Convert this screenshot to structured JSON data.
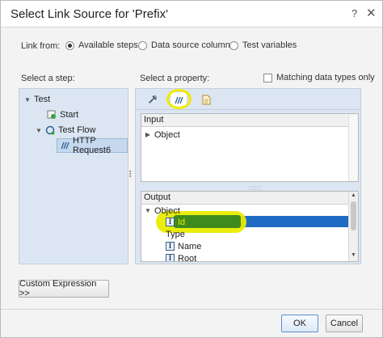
{
  "window": {
    "title": "Select Link Source for 'Prefix'",
    "help": "?",
    "close": "✕"
  },
  "link_from": {
    "label": "Link from:",
    "options": [
      {
        "label": "Available steps",
        "selected": true
      },
      {
        "label": "Data source column",
        "selected": false
      },
      {
        "label": "Test variables",
        "selected": false
      }
    ]
  },
  "steps": {
    "label": "Select a step:",
    "tree": [
      {
        "label": "Test",
        "icon": "chevron-down-icon"
      },
      {
        "label": "Start",
        "icon": "start-step-icon"
      },
      {
        "label": "Test Flow",
        "icon": "flow-icon"
      },
      {
        "label": "HTTP Request6",
        "icon": "http-request-icon"
      }
    ]
  },
  "property": {
    "label": "Select a property:",
    "matching_label": "Matching data types only",
    "tabs": [
      "tools-tab",
      "http-tab",
      "document-tab"
    ],
    "input": {
      "header": "Input",
      "rows": [
        "Object"
      ]
    },
    "output": {
      "header": "Output",
      "rows": [
        "Object",
        "Id",
        "Type",
        "Name",
        "Root"
      ]
    }
  },
  "buttons": {
    "custom_expression": "Custom Expression >>",
    "ok": "OK",
    "cancel": "Cancel"
  },
  "colors": {
    "panel_bg": "#dbe6f2",
    "selection": "#1f6bc4",
    "highlight_yellow": "#e9ec00"
  }
}
